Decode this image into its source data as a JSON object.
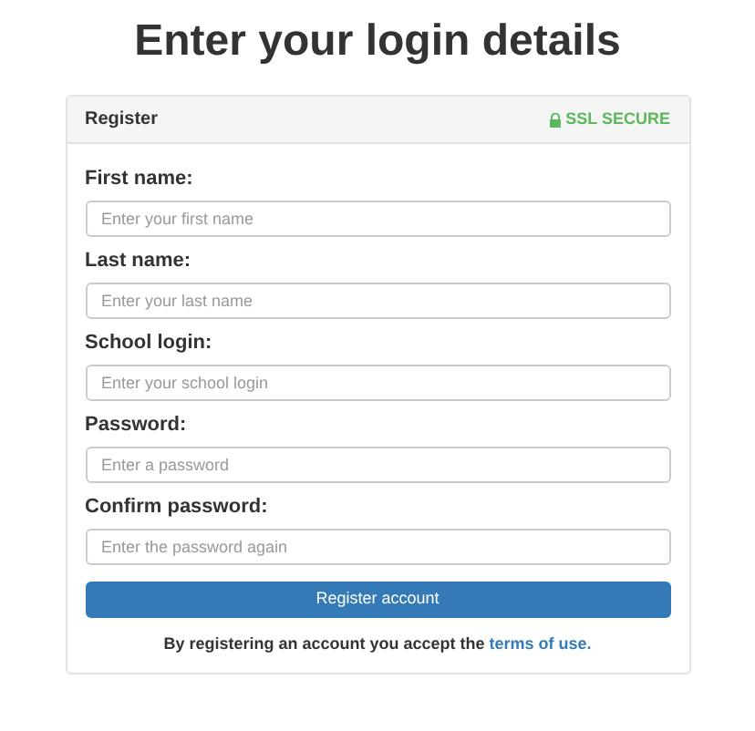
{
  "title": "Enter your login details",
  "panel": {
    "title": "Register",
    "badge": "SSL SECURE"
  },
  "fields": [
    {
      "label": "First name:",
      "placeholder": "Enter your first name"
    },
    {
      "label": "Last name:",
      "placeholder": "Enter your last name"
    },
    {
      "label": "School login:",
      "placeholder": "Enter your school login"
    },
    {
      "label": "Password:",
      "placeholder": "Enter a password"
    },
    {
      "label": "Confirm password:",
      "placeholder": "Enter the password again"
    }
  ],
  "submit": "Register account",
  "footer": {
    "text": "By registering an account you accept the ",
    "link": "terms of use."
  }
}
